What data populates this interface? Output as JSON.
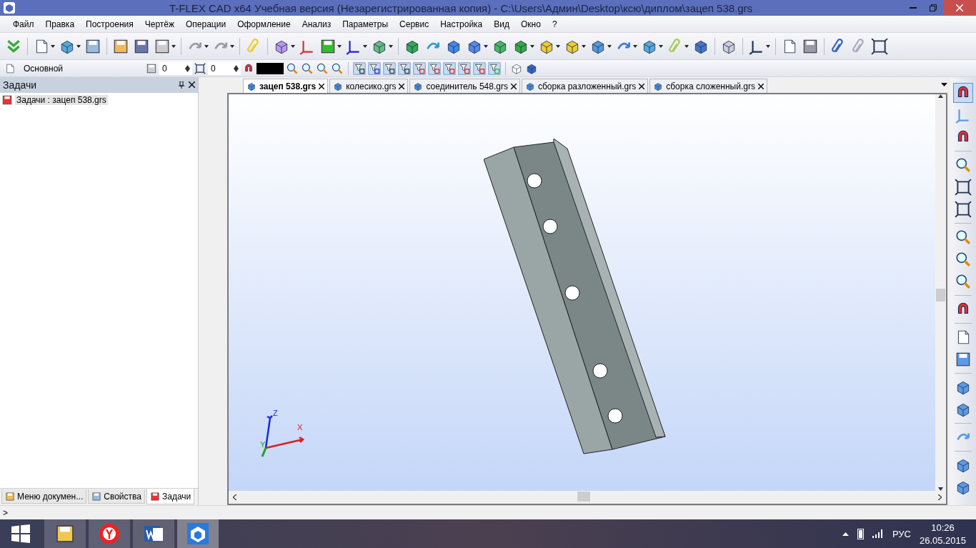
{
  "window": {
    "title": "T-FLEX CAD x64 Учебная версия (Незарегистрированная копия) - C:\\Users\\Админ\\Desktop\\ксю\\диплом\\зацеп 538.grs"
  },
  "menu": [
    "Файл",
    "Правка",
    "Построения",
    "Чертёж",
    "Операции",
    "Оформление",
    "Анализ",
    "Параметры",
    "Сервис",
    "Настройка",
    "Вид",
    "Окно",
    "?"
  ],
  "properties_bar": {
    "style": "Основной",
    "layer": "0",
    "level": "0"
  },
  "tasks_panel": {
    "title": "Задачи",
    "item": "Задачи : зацеп 538.grs"
  },
  "panel_tabs": [
    {
      "label": "Меню докумен...",
      "selected": false
    },
    {
      "label": "Свойства",
      "selected": false
    },
    {
      "label": "Задачи",
      "selected": true
    }
  ],
  "document_tabs": [
    {
      "label": "зацеп 538.grs",
      "selected": true
    },
    {
      "label": "колесико.grs",
      "selected": false
    },
    {
      "label": "соединитель 548.grs",
      "selected": false
    },
    {
      "label": "сборка разложенный.grs",
      "selected": false
    },
    {
      "label": "сборка сложенный.grs",
      "selected": false
    }
  ],
  "viewport": {
    "axes": [
      "Z",
      "X",
      "Y"
    ]
  },
  "command_line": {
    "prompt": ">"
  },
  "taskbar": {
    "language": "РУС",
    "time": "10:26",
    "date": "26.05.2015"
  }
}
